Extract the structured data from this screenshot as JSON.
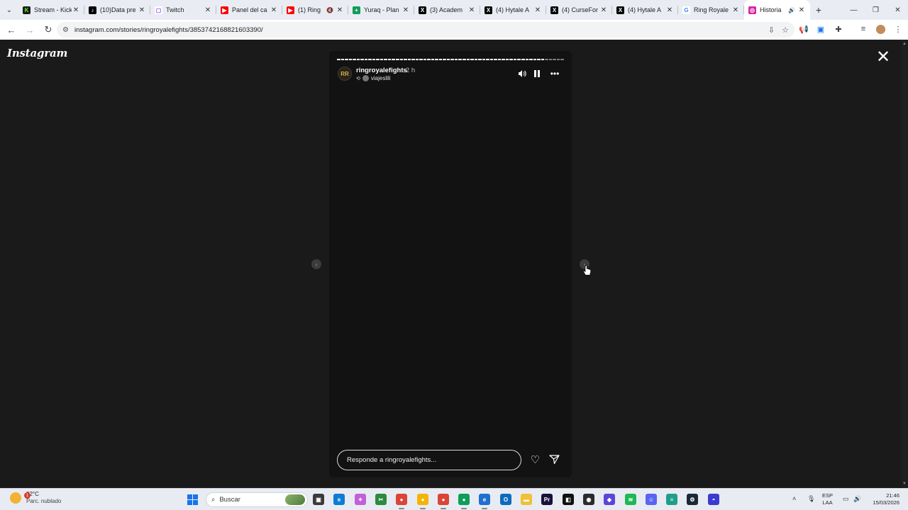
{
  "browser": {
    "tabs": [
      {
        "label": "Stream - Kick",
        "fav_color": "#1a1a1a",
        "fav_glyph": "K",
        "fav_text_color": "#53fc18"
      },
      {
        "label": "(10)Data pre",
        "fav_color": "#000000",
        "fav_glyph": "♪",
        "fav_text_color": "#ffffff"
      },
      {
        "label": "Twitch",
        "fav_color": "#ffffff",
        "fav_glyph": "▢",
        "fav_text_color": "#9146ff"
      },
      {
        "label": "Panel del ca",
        "fav_color": "#ff0000",
        "fav_glyph": "▶",
        "fav_text_color": "#ffffff"
      },
      {
        "label": "(1) Ring",
        "fav_color": "#ff0000",
        "fav_glyph": "▶",
        "fav_text_color": "#ffffff",
        "muted": true
      },
      {
        "label": "Yuraq - Plan",
        "fav_color": "#0f9d58",
        "fav_glyph": "+",
        "fav_text_color": "#ffffff"
      },
      {
        "label": "(3) Academ",
        "fav_color": "#000000",
        "fav_glyph": "X",
        "fav_text_color": "#ffffff"
      },
      {
        "label": "(4) Hytale A",
        "fav_color": "#000000",
        "fav_glyph": "X",
        "fav_text_color": "#ffffff"
      },
      {
        "label": "(4) CurseFor",
        "fav_color": "#000000",
        "fav_glyph": "X",
        "fav_text_color": "#ffffff"
      },
      {
        "label": "(4) Hytale A",
        "fav_color": "#000000",
        "fav_glyph": "X",
        "fav_text_color": "#ffffff"
      },
      {
        "label": "Ring Royale",
        "fav_color": "#ffffff",
        "fav_glyph": "G",
        "fav_text_color": "#4285f4"
      },
      {
        "label": "Historia",
        "fav_color": "#d6249f",
        "fav_glyph": "◎",
        "fav_text_color": "#ffffff",
        "active": true,
        "audio": true
      }
    ],
    "url": "instagram.com/stories/ringroyalefights/3853742168821603390/"
  },
  "instagram": {
    "logo": "Instagram",
    "story": {
      "username": "ringroyalefights",
      "time_ago": "2 h",
      "reposted_from": "viajeslili",
      "avatar_text": "RR",
      "progress_segments": 58,
      "progress_done": 53,
      "reply_placeholder": "Responde a ringroyalefights...",
      "accent": "#ffffff",
      "background": "#121213"
    }
  },
  "taskbar": {
    "weather_temp": "22°C",
    "weather_condition": "Parc. nublado",
    "weather_badge": "1",
    "search_placeholder": "Buscar",
    "lang_top": "ESP",
    "lang_bottom": "LAA",
    "time": "21:46",
    "date": "15/03/2026",
    "apps": [
      {
        "name": "task-view-icon",
        "color": "#3a3a3a",
        "glyph": "▣"
      },
      {
        "name": "edge-icon",
        "color": "#0c7cd5",
        "glyph": "e"
      },
      {
        "name": "copilot-icon",
        "color": "#c35fd8",
        "glyph": "✦"
      },
      {
        "name": "snipping-tool-icon",
        "color": "#2b8a3e",
        "glyph": "✂"
      },
      {
        "name": "chrome-icon",
        "color": "#db4437",
        "glyph": "●"
      },
      {
        "name": "chrome-icon-2",
        "color": "#f4b400",
        "glyph": "●"
      },
      {
        "name": "chrome-icon-3",
        "color": "#db4437",
        "glyph": "●"
      },
      {
        "name": "chrome-icon-4",
        "color": "#0f9d58",
        "glyph": "●"
      },
      {
        "name": "edge-icon-2",
        "color": "#1f6fd1",
        "glyph": "e"
      },
      {
        "name": "outlook-icon",
        "color": "#0f6cbd",
        "glyph": "O"
      },
      {
        "name": "file-explorer-icon",
        "color": "#f2c037",
        "glyph": "▬"
      },
      {
        "name": "premiere-icon",
        "color": "#1a0f3d",
        "glyph": "Pr"
      },
      {
        "name": "capcut-icon",
        "color": "#111111",
        "glyph": "◧"
      },
      {
        "name": "obs-icon",
        "color": "#2b2b2b",
        "glyph": "◉"
      },
      {
        "name": "vpn-icon",
        "color": "#5b46d6",
        "glyph": "◆"
      },
      {
        "name": "spotify-icon",
        "color": "#1db954",
        "glyph": "≋"
      },
      {
        "name": "discord-icon",
        "color": "#5865f2",
        "glyph": "☺"
      },
      {
        "name": "notes-icon",
        "color": "#1f9e8a",
        "glyph": "≡"
      },
      {
        "name": "steam-icon",
        "color": "#1b2838",
        "glyph": "⚙"
      },
      {
        "name": "app-icon",
        "color": "#3b3bd1",
        "glyph": "◓"
      }
    ]
  }
}
